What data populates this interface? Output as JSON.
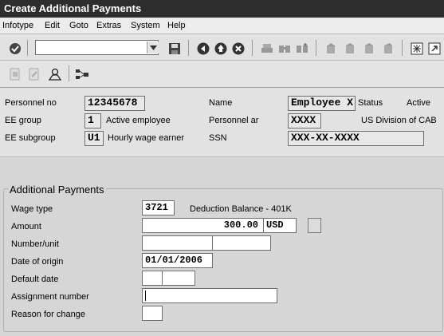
{
  "window": {
    "title": "Create Additional Payments"
  },
  "menu": [
    "Infotype",
    "Edit",
    "Goto",
    "Extras",
    "System",
    "Help"
  ],
  "toolbar": {
    "command_value": "",
    "icons": [
      "enter-icon",
      "save-icon",
      "back-icon",
      "exit-icon",
      "cancel-icon",
      "print-icon",
      "find-icon",
      "find-next-icon",
      "first-page-icon",
      "previous-page-icon",
      "next-page-icon",
      "last-page-icon",
      "create-session-icon",
      "shortcut-icon"
    ]
  },
  "app_toolbar": {
    "icons": [
      "copy-icon",
      "edit-icon",
      "person-icon",
      "org-structure-icon"
    ]
  },
  "header": {
    "personnel_no_label": "Personnel no",
    "personnel_no": "12345678",
    "ee_group_label": "EE group",
    "ee_group_code": "1",
    "ee_group_text": "Active employee",
    "ee_subgroup_label": "EE subgroup",
    "ee_subgroup_code": "U1",
    "ee_subgroup_text": "Hourly wage earner",
    "name_label": "Name",
    "name": "Employee X",
    "status_label": "Status",
    "status": "Active",
    "personnel_area_label": "Personnel ar",
    "personnel_area_code": "XXXX",
    "personnel_area_text": "US Division of CAB",
    "ssn_label": "SSN",
    "ssn": "XXX-XX-XXXX"
  },
  "form": {
    "section_title": "Additional Payments",
    "wage_type_label": "Wage type",
    "wage_type": "3721",
    "wage_type_text": "Deduction Balance - 401K",
    "amount_label": "Amount",
    "amount": "300.00",
    "currency": "USD",
    "number_unit_label": "Number/unit",
    "date_of_origin_label": "Date of origin",
    "date_of_origin": "01/01/2006",
    "default_date_label": "Default date",
    "assignment_number_label": "Assignment number",
    "assignment_number": "",
    "reason_for_change_label": "Reason for change",
    "reason_for_change": ""
  }
}
